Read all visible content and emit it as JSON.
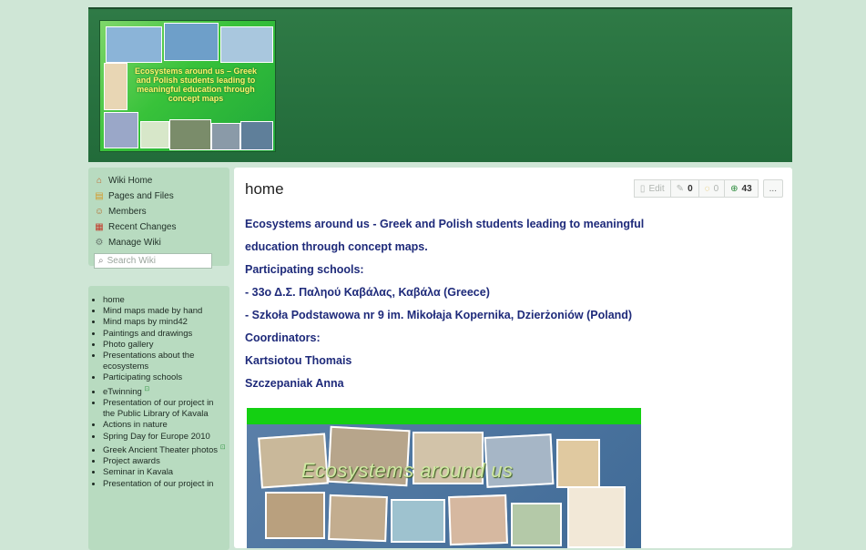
{
  "header": {
    "logo_text": "Ecosystems around us – Greek and Polish students leading to meaningful education through concept maps"
  },
  "sidebar": {
    "links": [
      {
        "label": "Wiki Home",
        "icon": "house-icon"
      },
      {
        "label": "Pages and Files",
        "icon": "folder-icon"
      },
      {
        "label": "Members",
        "icon": "members-icon"
      },
      {
        "label": "Recent Changes",
        "icon": "calendar-icon"
      },
      {
        "label": "Manage Wiki",
        "icon": "gear-icon"
      }
    ],
    "search_placeholder": "Search Wiki",
    "nav": [
      {
        "label": "home"
      },
      {
        "label": "Mind maps made by hand"
      },
      {
        "label": "Mind maps by mind42"
      },
      {
        "label": "Paintings and drawings"
      },
      {
        "label": "Photo gallery"
      },
      {
        "label": "Presentations about the ecosystems"
      },
      {
        "label": "Participating schools"
      },
      {
        "label": "eTwinning",
        "ext": "⊡"
      },
      {
        "label": "Presentation of our project in the Public Library of Kavala"
      },
      {
        "label": "Actions in nature"
      },
      {
        "label": "Spring Day for Europe 2010"
      },
      {
        "label": "Greek Ancient Theater photos",
        "ext": "⊡"
      },
      {
        "label": "Project awards"
      },
      {
        "label": "Seminar in Kavala"
      },
      {
        "label": "Presentation of our project in"
      }
    ]
  },
  "main": {
    "title": "home",
    "toolbar": {
      "edit": "Edit",
      "tags_count": "0",
      "comments_count": "0",
      "revisions_count": "43",
      "more": "..."
    },
    "lines": [
      "Ecosystems around us - Greek and Polish students leading to meaningful",
      "education through concept maps.",
      "Participating schools:",
      "- 33ο Δ.Σ. Παληού Καβάλας, Καβάλα (Greece)",
      "- Szkoła Podstawowa nr 9 im. Mikołaja Kopernika, Dzierżoniów (Poland)",
      "Coordinators:",
      "Kartsiotou Thomais",
      "Szczepaniak Anna"
    ],
    "photo_caption": "Ecosystems around us"
  }
}
